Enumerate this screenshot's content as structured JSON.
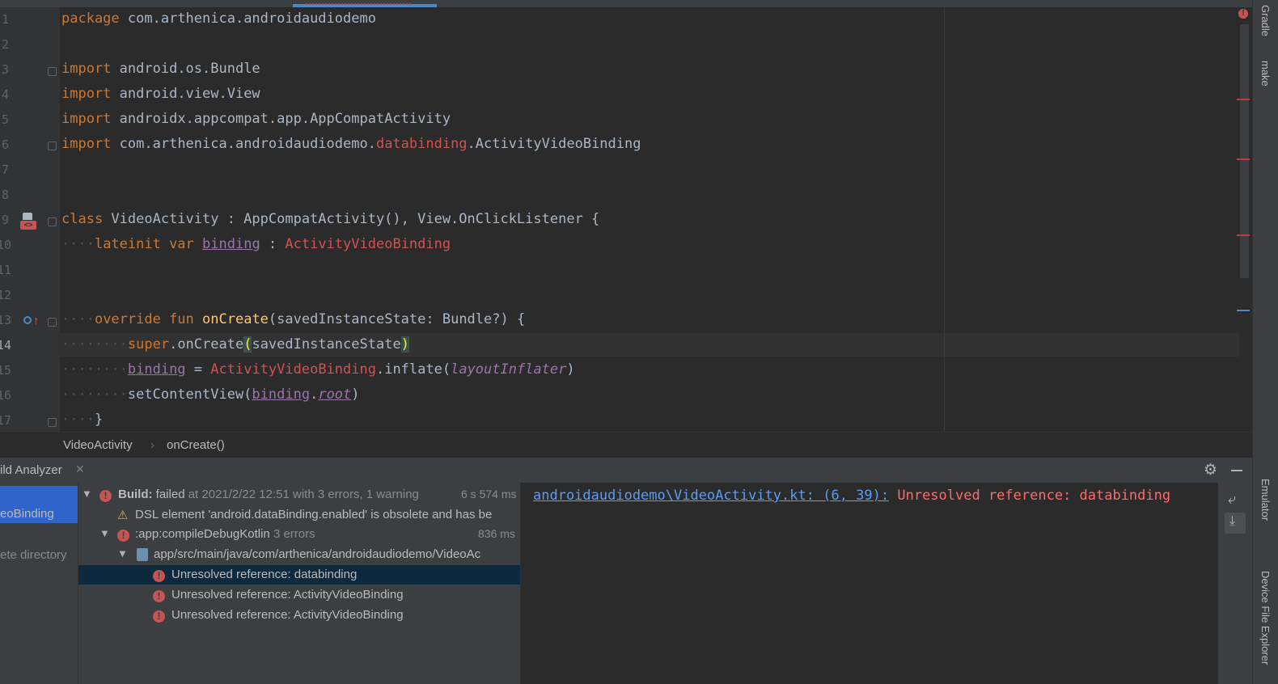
{
  "editor": {
    "lines": [
      {
        "n": "1"
      },
      {
        "n": "2"
      },
      {
        "n": "3"
      },
      {
        "n": "4"
      },
      {
        "n": "5"
      },
      {
        "n": "6"
      },
      {
        "n": "7"
      },
      {
        "n": "8"
      },
      {
        "n": "9"
      },
      {
        "n": "10"
      },
      {
        "n": "11"
      },
      {
        "n": "12"
      },
      {
        "n": "13"
      },
      {
        "n": "14"
      },
      {
        "n": "15"
      },
      {
        "n": "16"
      },
      {
        "n": "17"
      }
    ],
    "tokens": {
      "package_kw": "package",
      "package_name": "com.arthenica.androidaudiodemo",
      "import_kw": "import",
      "imp1": "android.os.Bundle",
      "imp2": "android.view.View",
      "imp3": "androidx.appcompat.app.AppCompatActivity",
      "imp4a": "com.arthenica.androidaudiodemo.",
      "imp4b": "databinding",
      "imp4c": ".ActivityVideoBinding",
      "class_kw": "class",
      "class_rest": " VideoActivity : AppCompatActivity(), View.OnClickListener {",
      "dots4": "····",
      "dots8": "········",
      "lateinit": "lateinit var",
      "binding": "binding",
      "colon": " : ",
      "avb": "ActivityVideoBinding",
      "override": "override fun",
      "oncreate": "onCreate",
      "oncreate_args": "(savedInstanceState: Bundle?) {",
      "super_kw": "super",
      "super_call": ".onCreate",
      "paren_open": "(",
      "saved": "savedInstanceState",
      "paren_close": ")",
      "eq": " = ",
      "inflate": ".inflate(",
      "layoutInflater": "layoutInflater",
      "close": ")",
      "setContent": "setContentView(",
      "dot": ".",
      "root": "root",
      "brace_close": "}"
    }
  },
  "breadcrumbs": [
    "VideoActivity",
    "onCreate()"
  ],
  "tool_window": {
    "title": "ild Analyzer",
    "left_items": [
      "eoBinding",
      "ete directory"
    ]
  },
  "build_tree": {
    "root_label_bold": "Build:",
    "root_label_status": "failed",
    "root_label_rest": "at 2021/2/22 12:51 with 3 errors, 1 warning",
    "root_time": "6 s 574 ms",
    "warning_text": "DSL element 'android.dataBinding.enabled' is obsolete and has be",
    "task_label": ":app:compileDebugKotlin",
    "task_errors": "3 errors",
    "task_time": "836 ms",
    "file_path": "app/src/main/java/com/arthenica/androidaudiodemo/VideoAc",
    "errors": [
      "Unresolved reference: databinding",
      "Unresolved reference: ActivityVideoBinding",
      "Unresolved reference: ActivityVideoBinding"
    ]
  },
  "console": {
    "link": "androidaudiodemo\\VideoActivity.kt: (6, 39):",
    "message": "Unresolved reference: databinding"
  },
  "right_strip": [
    "Gradle",
    "make",
    "Emulator",
    "Device File Explorer"
  ],
  "colors": {
    "accent": "#4a88c7",
    "error": "#c75450",
    "keyword": "#cc7832",
    "selection": "#0d293e"
  }
}
